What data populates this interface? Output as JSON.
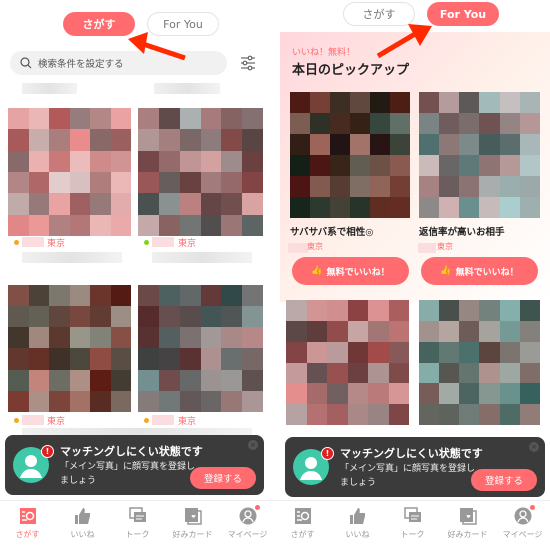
{
  "accent": "#ff6b6f",
  "tabs": {
    "search": "さがす",
    "foryou": "For You"
  },
  "search": {
    "placeholder": "検索条件を設定する",
    "filter_icon": "sliders-icon"
  },
  "left_cards": [
    {
      "city": "東京",
      "status_color": "#f5a623"
    },
    {
      "city": "東京",
      "status_color": "#7ed321"
    },
    {
      "city": "東京",
      "status_color": "#f5a623"
    },
    {
      "city": "東京",
      "status_color": "#f5a623"
    }
  ],
  "pickup": {
    "subtitle": "いいね！無料！",
    "title": "本日のピックアップ",
    "cards": [
      {
        "title": "サバサバ系で相性◎",
        "city": "東京",
        "button": "無料でいいね！"
      },
      {
        "title": "返信率が高いお相手",
        "city": "東京",
        "button": "無料でいいね！"
      }
    ]
  },
  "banner": {
    "title": "マッチングしにくい状態です",
    "message": "「メイン写真」に顔写真を登録しましょう",
    "button": "登録する",
    "alert": "!"
  },
  "nav": [
    {
      "label": "さがす",
      "icon": "search-list-icon",
      "active": true
    },
    {
      "label": "いいね",
      "icon": "thumbs-up-icon"
    },
    {
      "label": "トーク",
      "icon": "chat-icon"
    },
    {
      "label": "好みカード",
      "icon": "card-heart-icon"
    },
    {
      "label": "マイページ",
      "icon": "user-icon",
      "badge": true
    }
  ]
}
